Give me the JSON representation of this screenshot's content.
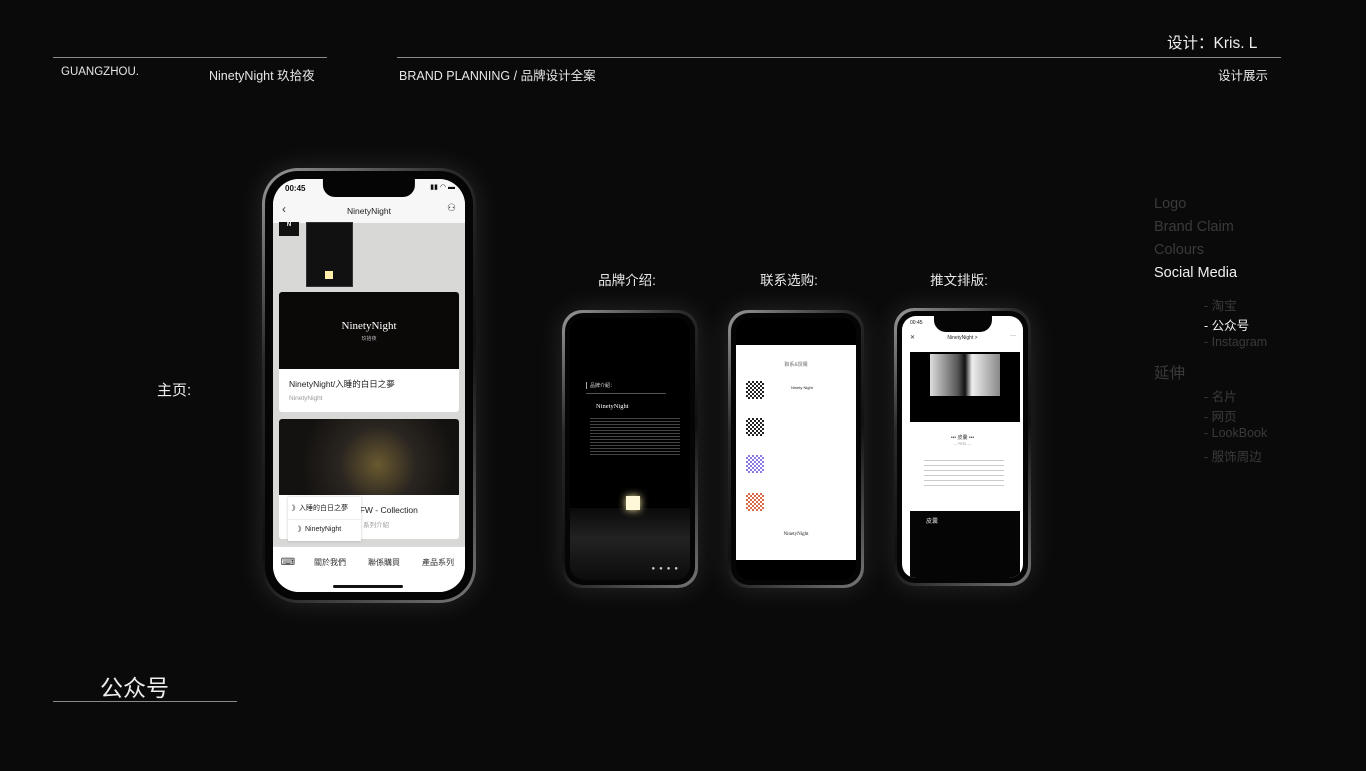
{
  "header": {
    "city": "GUANGZHOU.",
    "brand": "NinetyNight 玖拾夜",
    "project": "BRAND PLANNING",
    "separator": "/",
    "project_cn": "品牌设计全案",
    "designer": "设计：Kris. L",
    "section": "设计展示"
  },
  "main_label": "主页:",
  "page_title": "公众号",
  "main_phone": {
    "time": "00:45",
    "title": "NinetyNight",
    "card1": {
      "logo": "NinetyNight",
      "logo_cn": "玖拾夜",
      "title": "NinetyNight/入睡的白日之夢",
      "source": "NinetyNight"
    },
    "card2": {
      "title": "1FW - Collection",
      "subtitle": "V 系列介紹"
    },
    "popup": [
      "》入睡的白日之夢",
      "》NinetyNight"
    ],
    "tabs": [
      "關於我們",
      "聯係購買",
      "產品系列"
    ]
  },
  "screens": [
    {
      "label": "品牌介绍:",
      "heading": "品牌介紹：",
      "logo": "NinetyNight"
    },
    {
      "label": "联系选购:",
      "heading": "聯系&撰購",
      "shop_name": "Ninety Night",
      "logo": "NinetyNight"
    },
    {
      "label": "推文排版:",
      "time": "00:45",
      "title": "NinetyNight >",
      "heading": "••• 皮囊 •••",
      "sub": "--- PEEL ---",
      "section": "皮囊"
    }
  ],
  "side_nav": {
    "items": [
      {
        "label": "Logo",
        "active": false
      },
      {
        "label": "Brand Claim",
        "active": false
      },
      {
        "label": "Colours",
        "active": false
      },
      {
        "label": "Social Media",
        "active": true
      }
    ],
    "social_sub": [
      {
        "label": "- 淘宝",
        "active": false
      },
      {
        "label": "- 公众号",
        "active": true
      },
      {
        "label": "- Instagram",
        "active": false
      }
    ],
    "extension": "延伸",
    "extension_sub": [
      "- 名片",
      "- 网页",
      "- LookBook",
      "- 服饰周边"
    ]
  },
  "colors": {
    "background": "#0a0a0a",
    "active": "#f0f0f0",
    "inactive": "#3a3a3a"
  }
}
